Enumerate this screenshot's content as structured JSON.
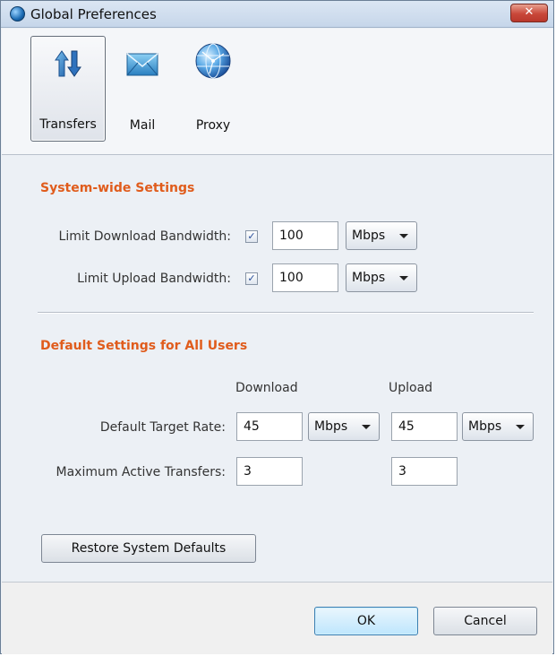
{
  "window": {
    "title": "Global Preferences",
    "close_glyph": "✕"
  },
  "toolbar": {
    "items": [
      {
        "label": "Transfers",
        "icon": "transfer-arrows-icon",
        "selected": true
      },
      {
        "label": "Mail",
        "icon": "envelope-icon",
        "selected": false
      },
      {
        "label": "Proxy",
        "icon": "globe-icon",
        "selected": false
      }
    ]
  },
  "system": {
    "title": "System-wide Settings",
    "download": {
      "label": "Limit Download Bandwidth:",
      "checked": true,
      "value": "100",
      "unit": "Mbps"
    },
    "upload": {
      "label": "Limit Upload Bandwidth:",
      "checked": true,
      "value": "100",
      "unit": "Mbps"
    }
  },
  "defaults": {
    "title": "Default Settings for All Users",
    "col_download": "Download",
    "col_upload": "Upload",
    "target_rate": {
      "label": "Default Target Rate:",
      "download_value": "45",
      "download_unit": "Mbps",
      "upload_value": "45",
      "upload_unit": "Mbps"
    },
    "max_active": {
      "label": "Maximum Active Transfers:",
      "download_value": "3",
      "upload_value": "3"
    }
  },
  "buttons": {
    "restore": "Restore System Defaults",
    "ok": "OK",
    "cancel": "Cancel"
  },
  "colors": {
    "section_title": "#e05c1c",
    "close_button": "#c9473a"
  }
}
